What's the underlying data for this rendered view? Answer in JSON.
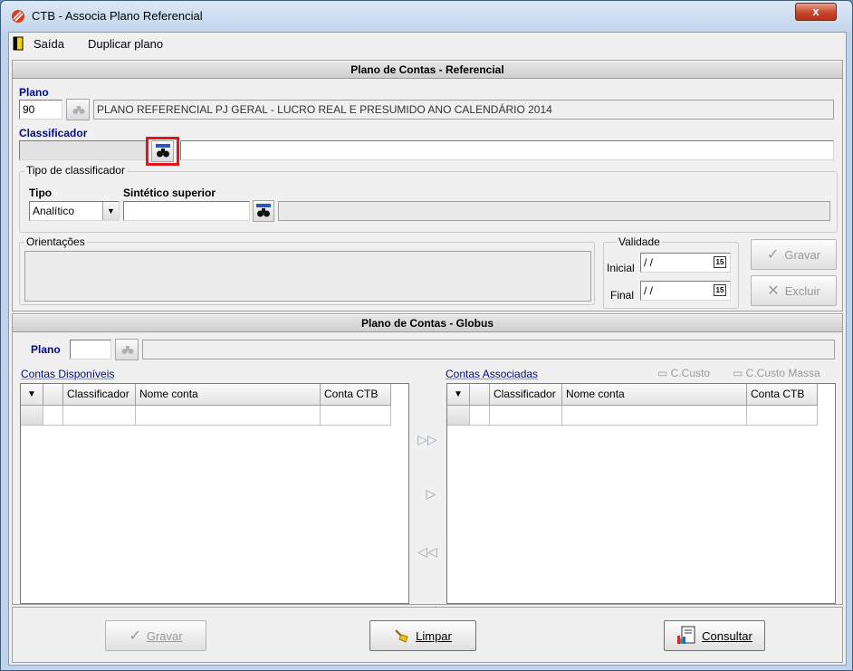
{
  "window": {
    "title": "CTB - Associa Plano Referencial",
    "close_glyph": "x"
  },
  "menu": {
    "items": [
      {
        "label": "Saída"
      },
      {
        "label": "Duplicar plano"
      }
    ]
  },
  "referencial": {
    "header": "Plano de Contas - Referencial",
    "plano_label": "Plano",
    "plano_code": "90",
    "plano_description": "PLANO REFERENCIAL PJ GERAL - LUCRO REAL E PRESUMIDO ANO CALENDÁRIO 2014",
    "classificador_label": "Classificador",
    "classificador_value": "",
    "classificador_desc": "",
    "tipo_group_title": "Tipo de classificador",
    "tipo_label": "Tipo",
    "tipo_value": "Analítico",
    "sintetico_label": "Sintético superior",
    "sintetico_value": "",
    "orientacoes_title": "Orientações",
    "validade_title": "Validade",
    "inicial_label": "Inicial",
    "inicial_value": " / /",
    "final_label": "Final",
    "final_value": " / /",
    "calendar_glyph": "15",
    "gravar_label": "Gravar",
    "excluir_label": "Excluir"
  },
  "globus": {
    "header": "Plano de Contas - Globus",
    "plano_label": "Plano",
    "plano_value": "",
    "contas_disponiveis_label": "Contas Disponíveis",
    "contas_associadas_label": "Contas Associadas",
    "ccusto_label": "C.Custo",
    "ccusto_massa_label": "C.Custo Massa",
    "columns": [
      "Classificador",
      "Nome conta",
      "Conta CTB"
    ],
    "arrows": {
      "add_all": "▷▷",
      "add": "▷",
      "remove_all": "◁◁",
      "remove": "◁"
    }
  },
  "footer": {
    "gravar_label": "Gravar",
    "limpar_label": "Limpar",
    "consultar_label": "Consultar"
  },
  "colors": {
    "highlight_box": "#e0161b",
    "label_blue": "#000c80"
  }
}
